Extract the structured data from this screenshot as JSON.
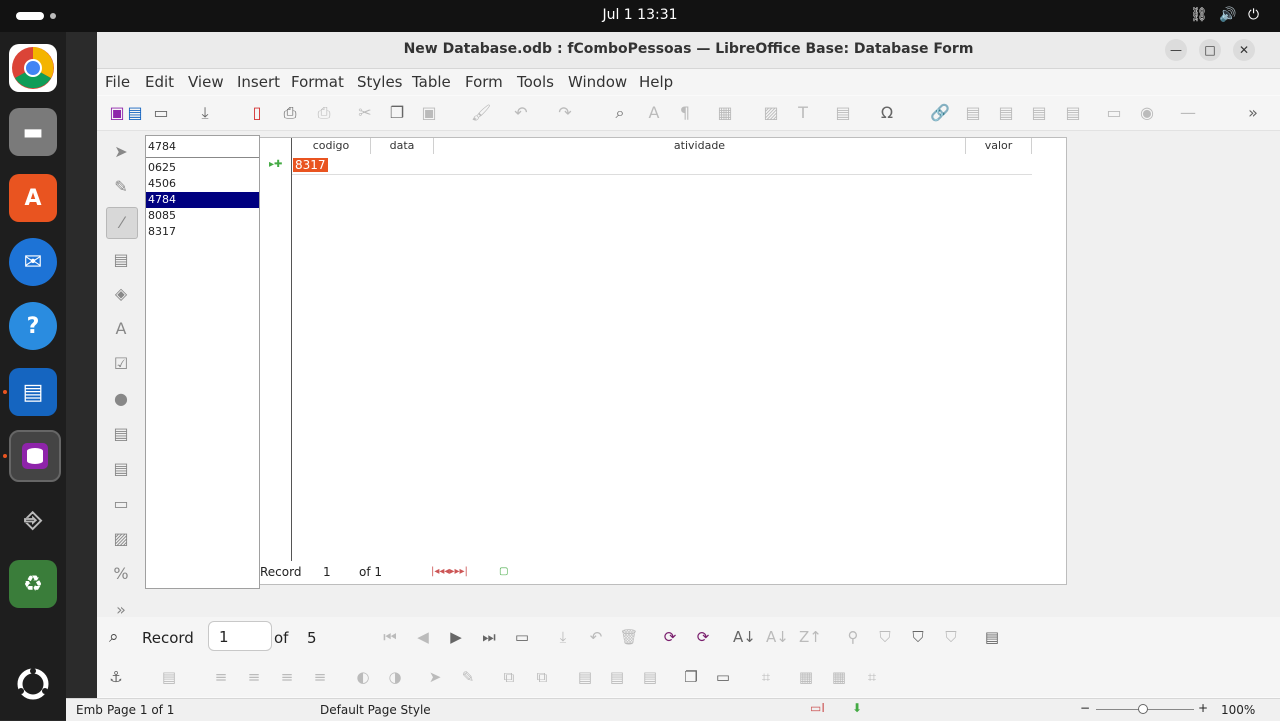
{
  "topbar": {
    "clock": "Jul 1  13:31"
  },
  "dock": {
    "apps": [
      "chrome-icon",
      "files-icon",
      "app-center-icon",
      "thunderbird-icon",
      "help-icon",
      "writer-icon",
      "base-icon",
      "usb-icon",
      "trash-icon",
      "show-apps-icon"
    ]
  },
  "window": {
    "title": "New Database.odb : fComboPessoas — LibreOffice Base: Database Form",
    "menu": [
      "File",
      "Edit",
      "View",
      "Insert",
      "Format",
      "Styles",
      "Table",
      "Form",
      "Tools",
      "Window",
      "Help"
    ]
  },
  "combo": {
    "value": "4784",
    "options": [
      "0625",
      "4506",
      "4784",
      "8085",
      "8317"
    ],
    "selected_index": 2
  },
  "grid": {
    "columns": [
      "codigo",
      "data",
      "atividade",
      "valor"
    ],
    "row": {
      "codigo": "8317",
      "data": "",
      "atividade": "",
      "valor": ""
    },
    "nav": {
      "label": "Record",
      "current": "1",
      "of": "of 1"
    }
  },
  "form_nav": {
    "label": "Record",
    "current": "1",
    "of": "of",
    "total": "5"
  },
  "status": {
    "section": "Emb",
    "page": "Page 1 of 1",
    "style": "Default Page Style",
    "zoom": "100%"
  },
  "accent": "#e95420",
  "selection_color": "#000080"
}
